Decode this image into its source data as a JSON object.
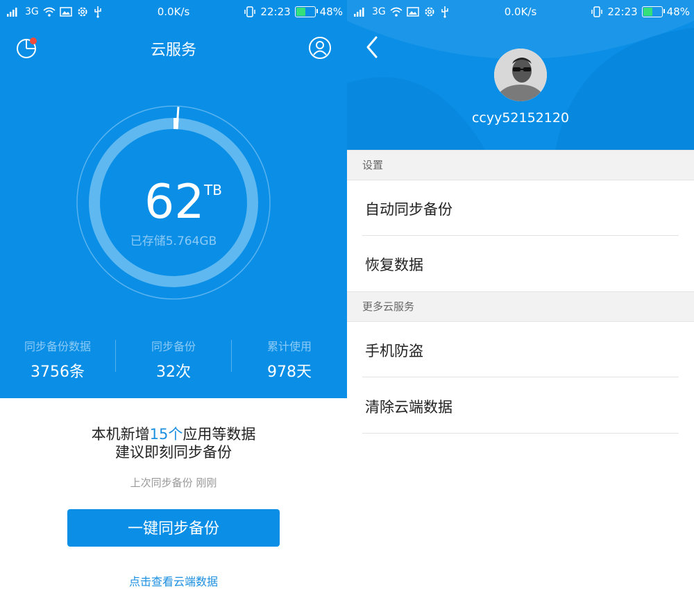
{
  "status_bar": {
    "network": "3G",
    "speed": "0.0K/s",
    "time": "22:23",
    "battery": "48%",
    "battery_level": 0.48
  },
  "left": {
    "title": "云服务",
    "capacity_value": "62",
    "capacity_unit": "TB",
    "used_text": "已存储5.764GB",
    "used_fraction": 0.01,
    "stats": [
      {
        "label": "同步备份数据",
        "value": "3756条"
      },
      {
        "label": "同步备份",
        "value": "32次"
      },
      {
        "label": "累计使用",
        "value": "978天"
      }
    ],
    "message_part1": "本机新增",
    "message_highlight": "15个",
    "message_part2": "应用等数据",
    "message_line2": "建议即刻同步备份",
    "last_sync": "上次同步备份 刚刚",
    "sync_button": "一键同步备份",
    "view_link": "点击查看云端数据",
    "colors": {
      "primary": "#0b8fe6",
      "highlight": "#1b8fe0",
      "notify_dot": "#f04a3a"
    }
  },
  "right": {
    "username": "ccyy52152120",
    "sections": [
      {
        "title": "设置",
        "items": [
          "自动同步备份",
          "恢复数据"
        ]
      },
      {
        "title": "更多云服务",
        "items": [
          "手机防盗",
          "清除云端数据"
        ]
      }
    ]
  }
}
